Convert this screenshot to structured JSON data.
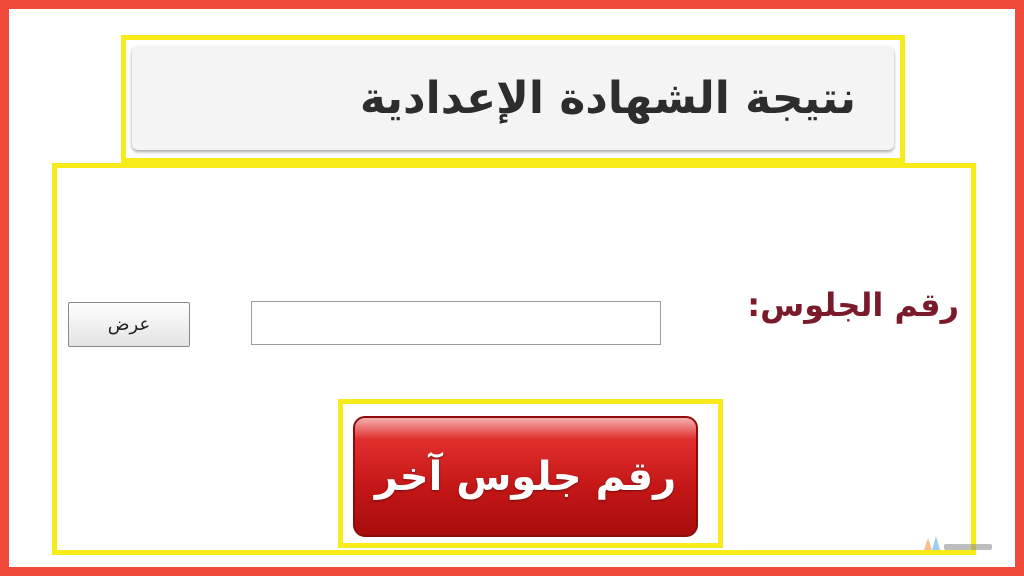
{
  "header": {
    "title": "نتيجة الشهادة الإعدادية"
  },
  "form": {
    "seat_label": "رقم الجلوس:",
    "seat_value": "",
    "show_button": "عرض"
  },
  "actions": {
    "other_seat_button": "رقم جلوس آخر"
  },
  "colors": {
    "frame": "#f04a3a",
    "highlight": "#f7ec1a",
    "label": "#7b1a2a",
    "button_red": "#c41616"
  },
  "icons": {
    "watermark": "site-logo-watermark"
  }
}
